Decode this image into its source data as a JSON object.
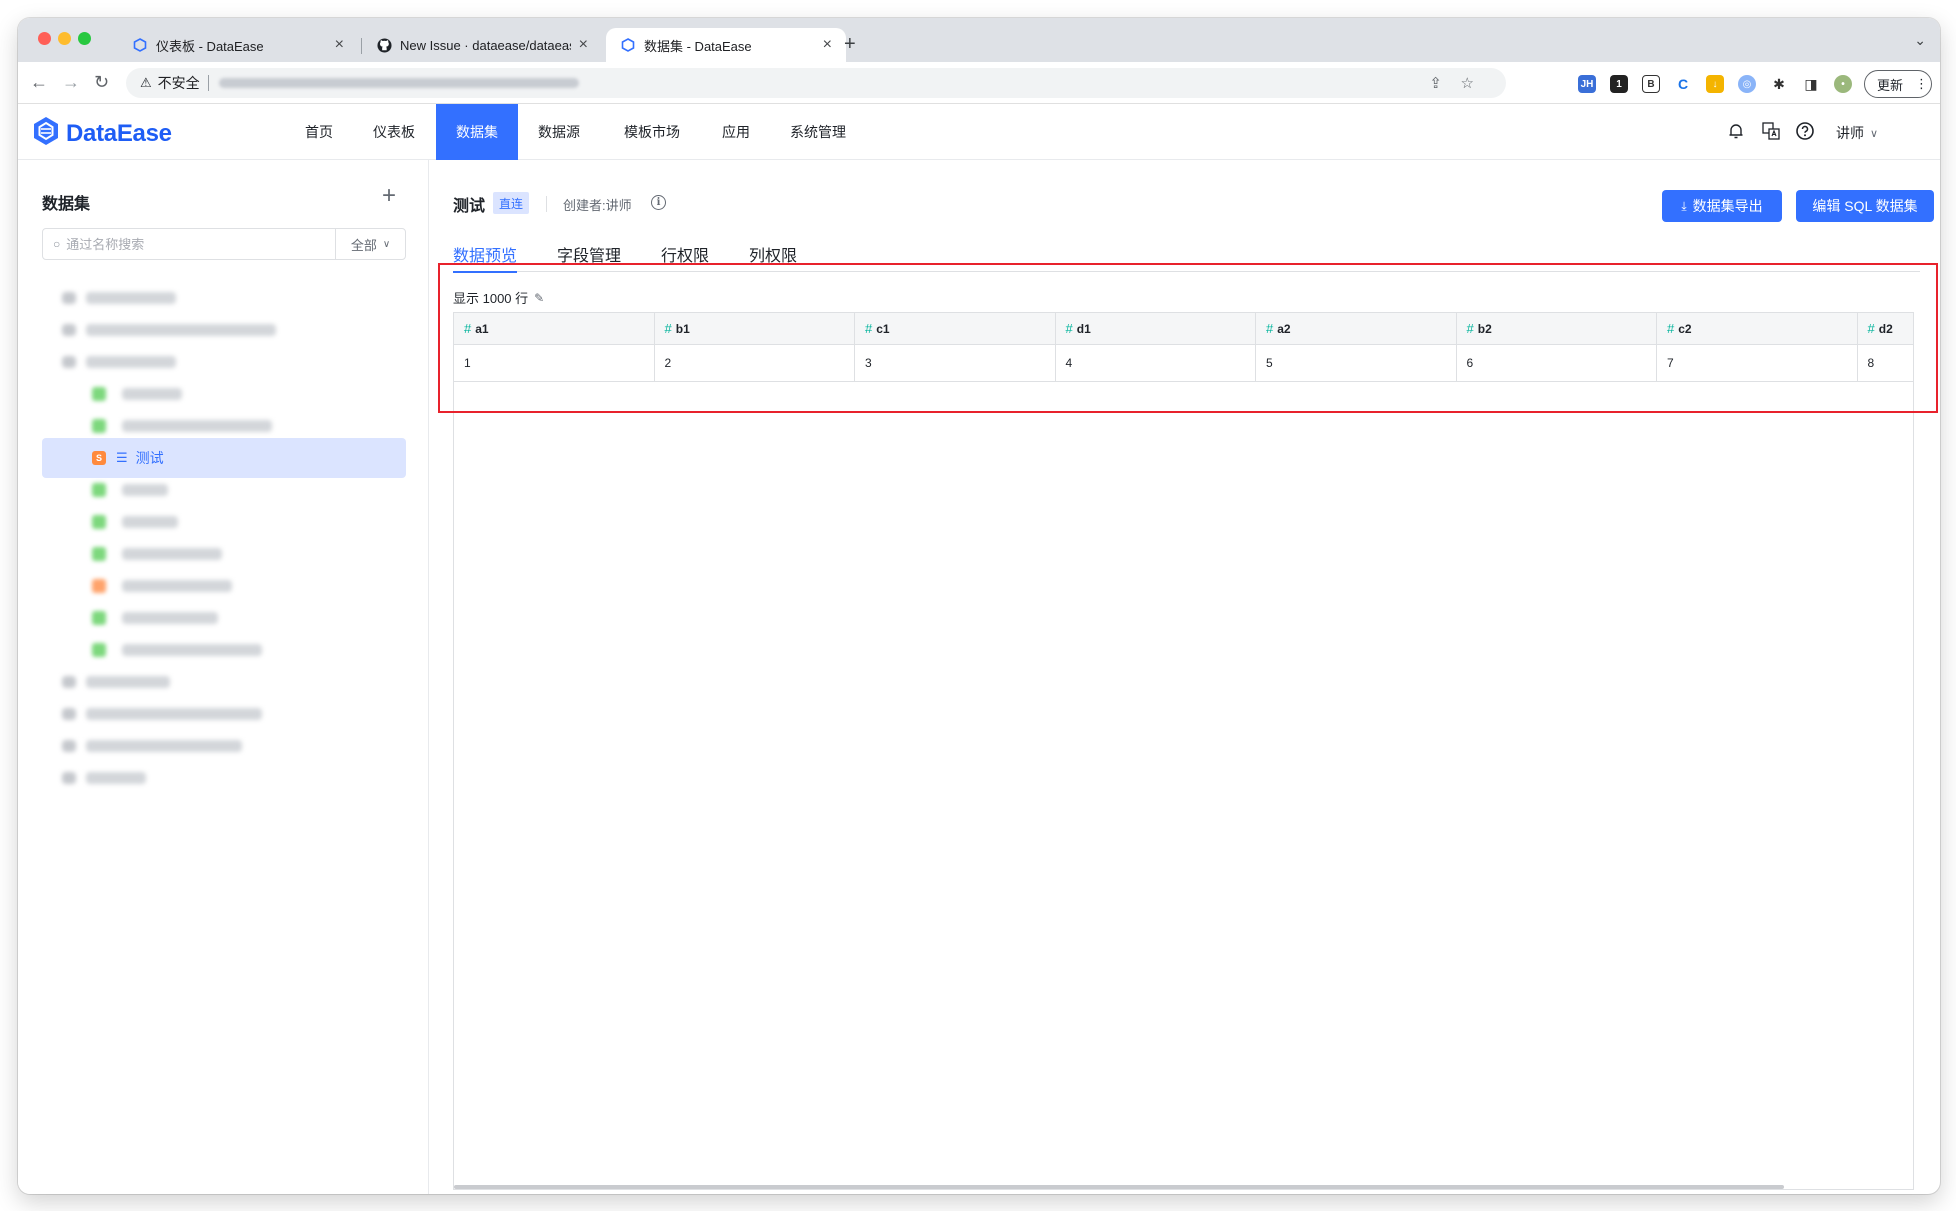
{
  "browser": {
    "tabs": [
      {
        "title": "仪表板 - DataEase",
        "icon": "dataease-icon"
      },
      {
        "title": "New Issue · dataease/dataease",
        "icon": "github-icon"
      },
      {
        "title": "数据集 - DataEase",
        "icon": "dataease-icon"
      }
    ],
    "insecure_label": "不安全",
    "update_label": "更新"
  },
  "app": {
    "logo": "DataEase",
    "nav": [
      "首页",
      "仪表板",
      "数据集",
      "数据源",
      "模板市场",
      "应用",
      "系统管理"
    ],
    "active_nav": "数据集",
    "user": "讲师"
  },
  "sidebar": {
    "title": "数据集",
    "search_placeholder": "通过名称搜索",
    "filter": "全部",
    "selected_item": "测试"
  },
  "main": {
    "dataset_name": "测试",
    "tag": "直连",
    "creator": "创建者:讲师",
    "export_button": "数据集导出",
    "edit_button": "编辑 SQL 数据集",
    "tabs": [
      "数据预览",
      "字段管理",
      "行权限",
      "列权限"
    ],
    "active_tab": "数据预览",
    "row_count_label": "显示 1000 行",
    "columns": [
      "a1",
      "b1",
      "c1",
      "d1",
      "a2",
      "b2",
      "c2",
      "d2"
    ],
    "rows": [
      [
        "1",
        "2",
        "3",
        "4",
        "5",
        "6",
        "7",
        "8"
      ]
    ]
  },
  "colors": {
    "primary": "#3370ff",
    "field_number": "#04b49c",
    "highlight": "#e8222c"
  }
}
